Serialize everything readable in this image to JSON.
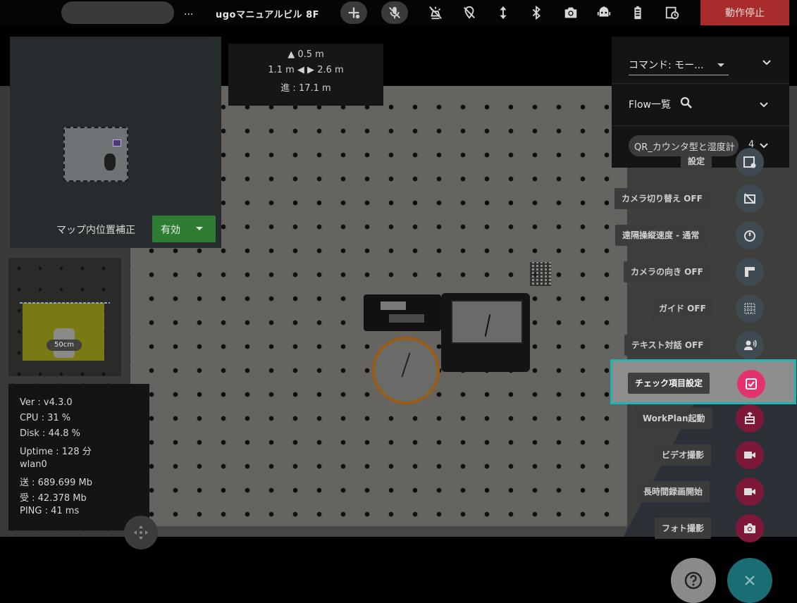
{
  "topbar": {
    "ellipsis": "...",
    "robot_name": "ugoマニュアルビル 8F",
    "icons": [
      "add-device-icon",
      "mic-off-icon",
      "light-off-icon",
      "location-off-icon",
      "up-down-arrow-icon",
      "bluetooth-icon",
      "camera-icon",
      "robot-icon",
      "battery-icon",
      "history-icon"
    ],
    "stop_label": "動作停止",
    "stop_color": "#a92c2c"
  },
  "distance": {
    "front": "0.5 m",
    "left": "1.1 m",
    "right": "2.6 m",
    "traveled": "進 : 17.1 m"
  },
  "map": {
    "correction_label": "マップ内位置補正",
    "correction_value": "有効"
  },
  "minicam": {
    "scale": "50cm"
  },
  "stats": {
    "ver": "Ver : v4.3.0",
    "cpu": "CPU : 31 %",
    "disk": "Disk : 44.8 %",
    "uptime": "Uptime : 128 分",
    "iface": "wlan0",
    "sent": "送 : 689.699 Mb",
    "recv": "受 : 42.378 Mb",
    "ping": "PING : 41 ms"
  },
  "command": {
    "mode_select": "コマンド: モー...",
    "flow_label": "Flow一覧",
    "flow_item": "QR_カウンタ型と湿度計",
    "flow_count": "4"
  },
  "actions": [
    {
      "label": "設定",
      "icon": "settings-card-icon",
      "style": "grey"
    },
    {
      "label": "カメラ切り替え OFF",
      "icon": "camera-switch-off-icon",
      "style": "grey"
    },
    {
      "label": "遠隔操縦速度 - 通常",
      "icon": "speed-gauge-icon",
      "style": "grey"
    },
    {
      "label": "カメラの向き OFF",
      "icon": "camera-direction-icon",
      "style": "grey"
    },
    {
      "label": "ガイド OFF",
      "icon": "guide-grid-icon",
      "style": "grey"
    },
    {
      "label": "テキスト対話 OFF",
      "icon": "voice-chat-icon",
      "style": "grey"
    },
    {
      "label": "チェック項目設定",
      "icon": "checklist-icon",
      "style": "hot"
    },
    {
      "label": "WorkPlan起動",
      "icon": "workplan-icon",
      "style": "pink"
    },
    {
      "label": "ビデオ撮影",
      "icon": "video-icon",
      "style": "pink"
    },
    {
      "label": "長時間録画開始",
      "icon": "long-record-icon",
      "style": "pink"
    },
    {
      "label": "フォト撮影",
      "icon": "photo-camera-icon",
      "style": "pink"
    }
  ],
  "colors": {
    "highlight": "#1fb5b0",
    "accent_pink": "#e3326d",
    "map_select_green": "#2e7d32"
  }
}
